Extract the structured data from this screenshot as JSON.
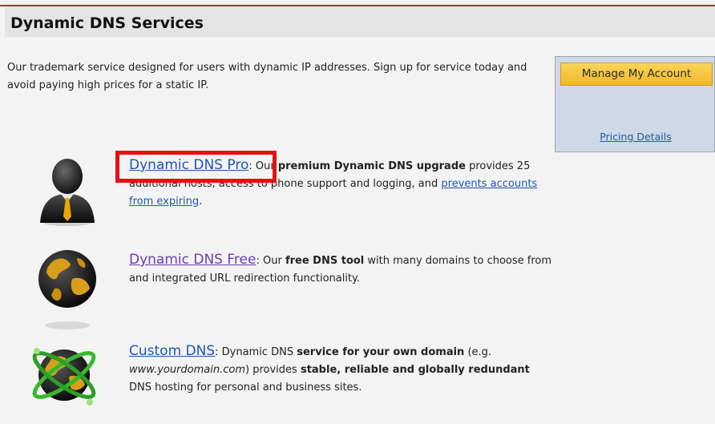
{
  "header": {
    "title": "Dynamic DNS Services"
  },
  "intro": {
    "line1": "Our trademark service designed for users with dynamic IP addresses. Sign up for service today and",
    "line2": "avoid paying high prices for a static IP."
  },
  "account": {
    "manage_label": "Manage My Account",
    "pricing_label": "Pricing Details"
  },
  "services": [
    {
      "title": "Dynamic DNS Pro",
      "sep": ": Our ",
      "bold": "premium Dynamic DNS upgrade",
      "text1": " provides 25 additional hosts, access to phone support and logging, and ",
      "link": "prevents accounts from expiring",
      "text2": "."
    },
    {
      "title": "Dynamic DNS Free",
      "sep": ": Our ",
      "bold": "free DNS tool",
      "text1": " with many domains to choose from and integrated URL redirection functionality."
    },
    {
      "title": "Custom DNS",
      "sep": ": Dynamic DNS ",
      "bold": "service for your own domain",
      "text1": " (e.g. ",
      "italic": "www.yourdomain.com",
      "text2": ") provides ",
      "bold2": "stable, reliable and globally redundant",
      "text3": " DNS hosting for personal and business sites."
    }
  ],
  "colors": {
    "link": "#1f56b3",
    "visited": "#6a3fb3",
    "highlight": "#e41212",
    "accent": "#f1b82a"
  },
  "icons": [
    "businessman-icon",
    "globe-icon",
    "orbit-globe-icon"
  ]
}
